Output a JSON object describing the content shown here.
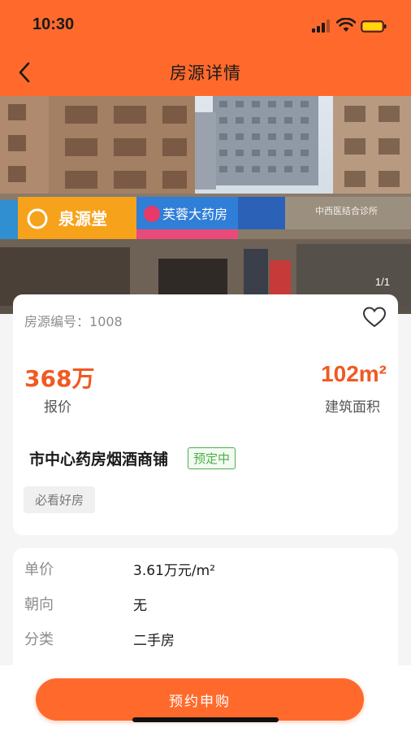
{
  "status_bar": {
    "time": "10:30"
  },
  "nav": {
    "title": "房源详情",
    "back_icon": "chevron-left-icon"
  },
  "photo": {
    "counter": "1/1",
    "signs": {
      "left_store": "泉源堂",
      "middle_store": "芙蓉大药房",
      "right_store": "中西医结合诊所"
    }
  },
  "listing": {
    "number_label": "房源编号：",
    "number": "1008",
    "price_value": "368万",
    "price_label": "报价",
    "area_value": "102m²",
    "area_label": "建筑面积",
    "title": "市中心药房烟酒商铺",
    "status": "预定中",
    "tag": "必看好房"
  },
  "details": [
    {
      "label": "单价",
      "value": "3.61万元/m²"
    },
    {
      "label": "朝向",
      "value": "无"
    },
    {
      "label": "分类",
      "value": "二手房"
    }
  ],
  "bottom": {
    "book_label": "预约申购"
  },
  "colors": {
    "accent": "#ff6a2c",
    "price": "#f05a23",
    "status_green": "#49b04a"
  }
}
